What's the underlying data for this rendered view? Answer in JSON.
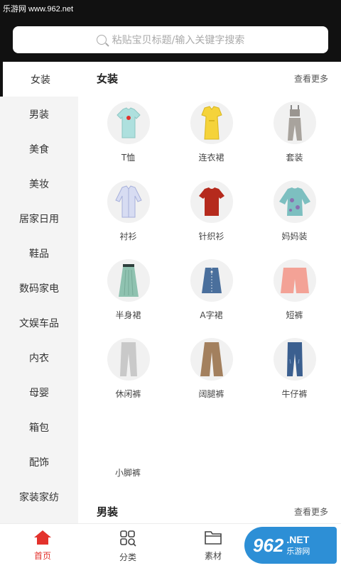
{
  "watermark": "乐游网 www.962.net",
  "search": {
    "placeholder": "粘贴宝贝标题/输入关键字搜索"
  },
  "sidebar": {
    "items": [
      {
        "label": "女装"
      },
      {
        "label": "男装"
      },
      {
        "label": "美食"
      },
      {
        "label": "美妆"
      },
      {
        "label": "居家日用"
      },
      {
        "label": "鞋品"
      },
      {
        "label": "数码家电"
      },
      {
        "label": "文娱车品"
      },
      {
        "label": "内衣"
      },
      {
        "label": "母婴"
      },
      {
        "label": "箱包"
      },
      {
        "label": "配饰"
      },
      {
        "label": "家装家纺"
      }
    ]
  },
  "section1": {
    "title": "女装",
    "more": "查看更多",
    "items": [
      {
        "label": "T恤",
        "icon": "tshirt-icon"
      },
      {
        "label": "连衣裙",
        "icon": "dress-icon"
      },
      {
        "label": "套装",
        "icon": "suit-icon"
      },
      {
        "label": "衬衫",
        "icon": "shirt-icon"
      },
      {
        "label": "针织衫",
        "icon": "knitwear-icon"
      },
      {
        "label": "妈妈装",
        "icon": "mom-clothing-icon"
      },
      {
        "label": "半身裙",
        "icon": "skirt-icon"
      },
      {
        "label": "A字裙",
        "icon": "a-line-skirt-icon"
      },
      {
        "label": "短裤",
        "icon": "shorts-icon"
      },
      {
        "label": "休闲裤",
        "icon": "casual-pants-icon"
      },
      {
        "label": "阔腿裤",
        "icon": "wide-leg-pants-icon"
      },
      {
        "label": "牛仔裤",
        "icon": "jeans-icon"
      }
    ],
    "extra": "小脚裤"
  },
  "section2": {
    "title": "男装",
    "more": "查看更多"
  },
  "tabs": [
    {
      "label": "首页"
    },
    {
      "label": "分类"
    },
    {
      "label": "素材"
    }
  ],
  "logo": {
    "num": "962",
    "net": ".NET",
    "cn": "乐游网"
  }
}
